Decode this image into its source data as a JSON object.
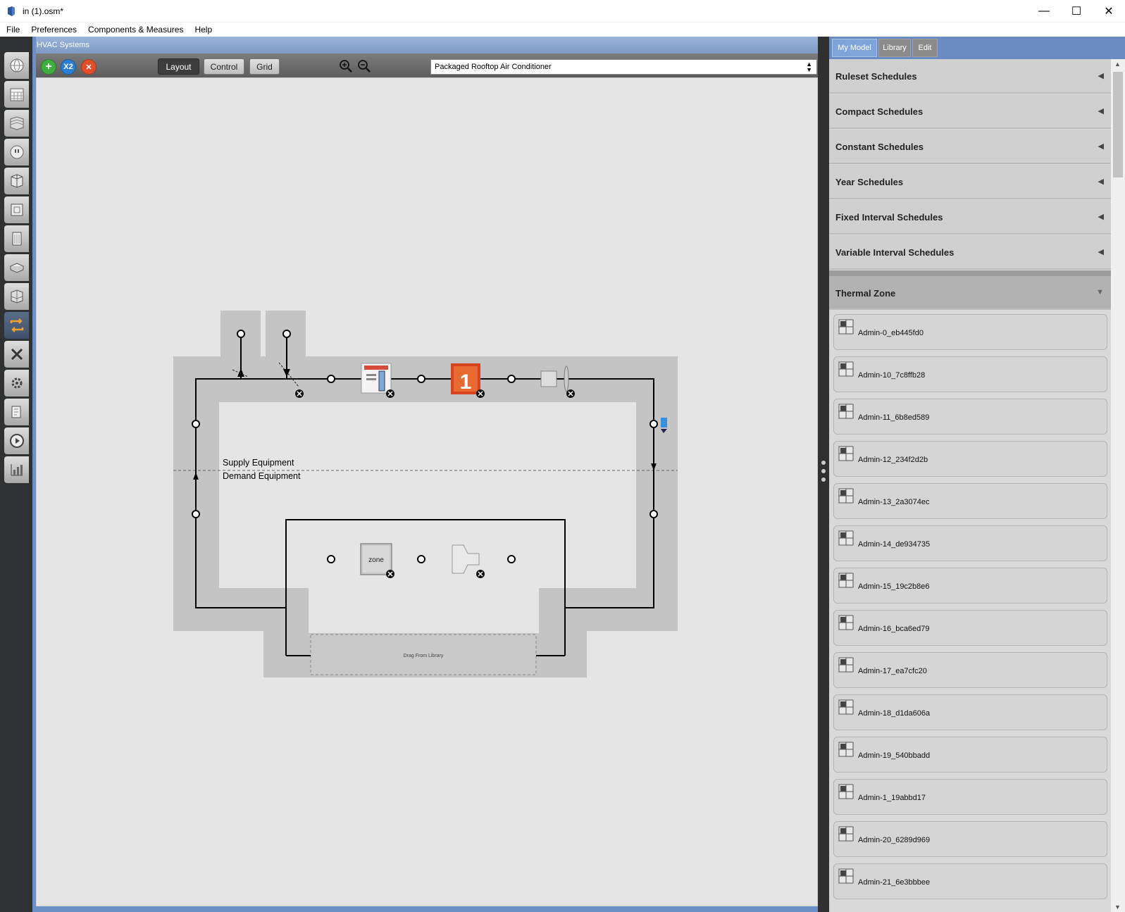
{
  "window": {
    "title": "in (1).osm*",
    "minimize": "—",
    "maximize": "☐",
    "close": "✕"
  },
  "menu": [
    "File",
    "Preferences",
    "Components & Measures",
    "Help"
  ],
  "hvac": {
    "header": "HVAC Systems",
    "add_label": "+",
    "copy_label": "X2",
    "delete_label": "✕",
    "layout_label": "Layout",
    "control_label": "Control",
    "grid_label": "Grid",
    "system_selected": "Packaged Rooftop Air Conditioner",
    "supply_label": "Supply Equipment",
    "demand_label": "Demand Equipment",
    "zone_label": "zone",
    "drag_label": "Drag From Library",
    "heating_coil_number": "1"
  },
  "right_panel": {
    "tabs": [
      "My Model",
      "Library",
      "Edit"
    ],
    "sections": [
      "Ruleset Schedules",
      "Compact Schedules",
      "Constant Schedules",
      "Year Schedules",
      "Fixed Interval Schedules",
      "Variable Interval Schedules"
    ],
    "expanded_section": "Thermal Zone",
    "zones": [
      "Admin-0_eb445fd0",
      "Admin-10_7c8ffb28",
      "Admin-11_6b8ed589",
      "Admin-12_234f2d2b",
      "Admin-13_2a3074ec",
      "Admin-14_de934735",
      "Admin-15_19c2b8e6",
      "Admin-16_bca6ed79",
      "Admin-17_ea7cfc20",
      "Admin-18_d1da606a",
      "Admin-19_540bbadd",
      "Admin-1_19abbd17",
      "Admin-20_6289d969",
      "Admin-21_6e3bbbee"
    ]
  },
  "icons": {
    "leftbar": [
      "site-icon",
      "schedules-icon",
      "constructions-icon",
      "loads-icon",
      "space-types-icon",
      "geometry-icon",
      "facility-icon",
      "spaces-icon",
      "thermal-zones-icon",
      "hvac-systems-icon",
      "output-variables-icon",
      "simulation-settings-icon",
      "measures-icon",
      "run-simulation-icon",
      "results-icon"
    ]
  },
  "colors": {
    "accent_blue": "#6b8fc7",
    "canvas": "#e5e5e5",
    "loop_bg": "#c4c4c4"
  }
}
